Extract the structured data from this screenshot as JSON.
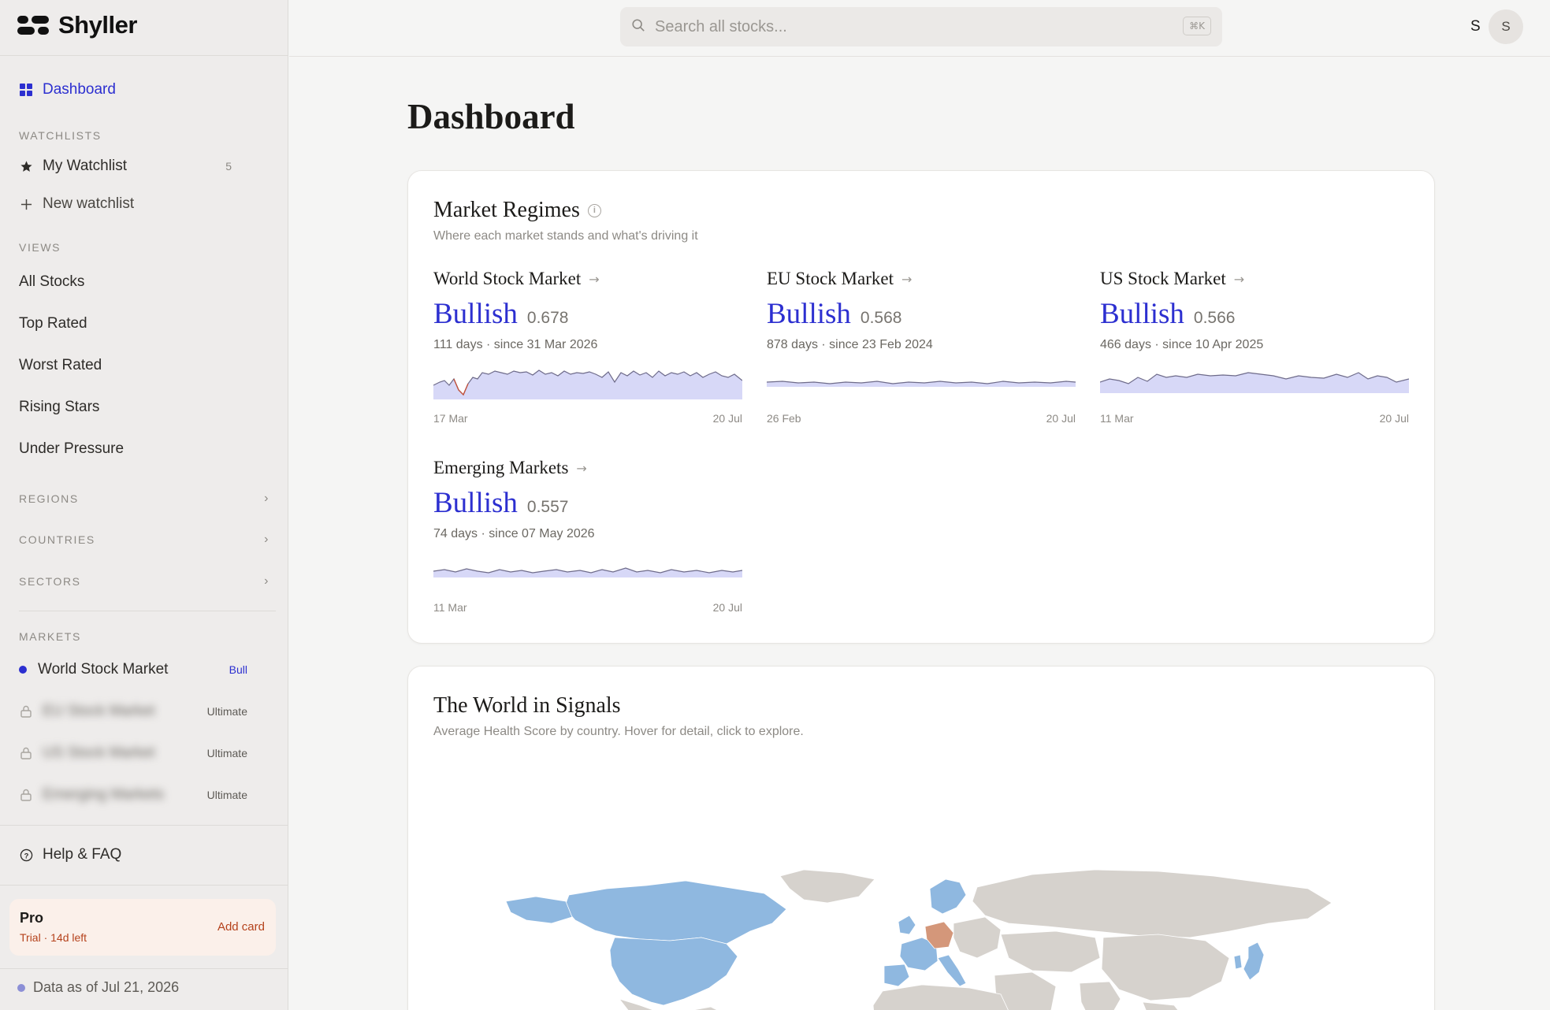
{
  "app": {
    "name": "Shyller"
  },
  "sidebar": {
    "dashboard_label": "Dashboard",
    "watchlists_heading": "WATCHLISTS",
    "my_watchlist": {
      "label": "My Watchlist",
      "count": "5"
    },
    "new_watchlist_label": "New watchlist",
    "views_heading": "VIEWS",
    "views": [
      "All Stocks",
      "Top Rated",
      "Worst Rated",
      "Rising Stars",
      "Under Pressure"
    ],
    "groups": [
      "REGIONS",
      "COUNTRIES",
      "SECTORS"
    ],
    "markets_heading": "MARKETS",
    "markets": [
      {
        "label": "World Stock Market",
        "tag": "Bull",
        "locked": false
      },
      {
        "label": "EU Stock Market",
        "tag": "Ultimate",
        "locked": true
      },
      {
        "label": "US Stock Market",
        "tag": "Ultimate",
        "locked": true
      },
      {
        "label": "Emerging Markets",
        "tag": "Ultimate",
        "locked": true
      }
    ],
    "help_label": "Help & FAQ",
    "plan": {
      "name": "Pro",
      "status": "Trial · 14d left",
      "action": "Add card"
    },
    "data_as_of": "Data as of Jul 21, 2026"
  },
  "header": {
    "search_placeholder": "Search all stocks...",
    "search_shortcut": "⌘K",
    "user_initial": "S",
    "avatar_initial": "S"
  },
  "page": {
    "title": "Dashboard"
  },
  "regimes": {
    "title": "Market Regimes",
    "subtitle": "Where each market stands and what's driving it",
    "markets": [
      {
        "name": "World Stock Market",
        "regime": "Bullish",
        "score": "0.678",
        "since": "111 days · since 31 Mar 2026",
        "start": "17 Mar",
        "end": "20 Jul"
      },
      {
        "name": "EU Stock Market",
        "regime": "Bullish",
        "score": "0.568",
        "since": "878 days · since 23 Feb 2024",
        "start": "26 Feb",
        "end": "20 Jul"
      },
      {
        "name": "US Stock Market",
        "regime": "Bullish",
        "score": "0.566",
        "since": "466 days · since 10 Apr 2025",
        "start": "11 Mar",
        "end": "20 Jul"
      },
      {
        "name": "Emerging Markets",
        "regime": "Bullish",
        "score": "0.557",
        "since": "74 days · since 07 May 2026",
        "start": "11 Mar",
        "end": "20 Jul"
      }
    ]
  },
  "world": {
    "title": "The World in Signals",
    "subtitle": "Average Health Score by country. Hover for detail, click to explore."
  },
  "colors": {
    "accent": "#2c2fd0",
    "bullish_country": "#8fb8e0",
    "bearish_country": "#d4977a",
    "neutral_country": "#d6d2cd",
    "trial": "#b5421c"
  },
  "icons": [
    "logo-icon",
    "dashboard-icon",
    "star-icon",
    "plus-icon",
    "chevron-right-icon",
    "lock-icon",
    "help-icon",
    "search-icon",
    "info-icon",
    "arrow-right-icon"
  ]
}
